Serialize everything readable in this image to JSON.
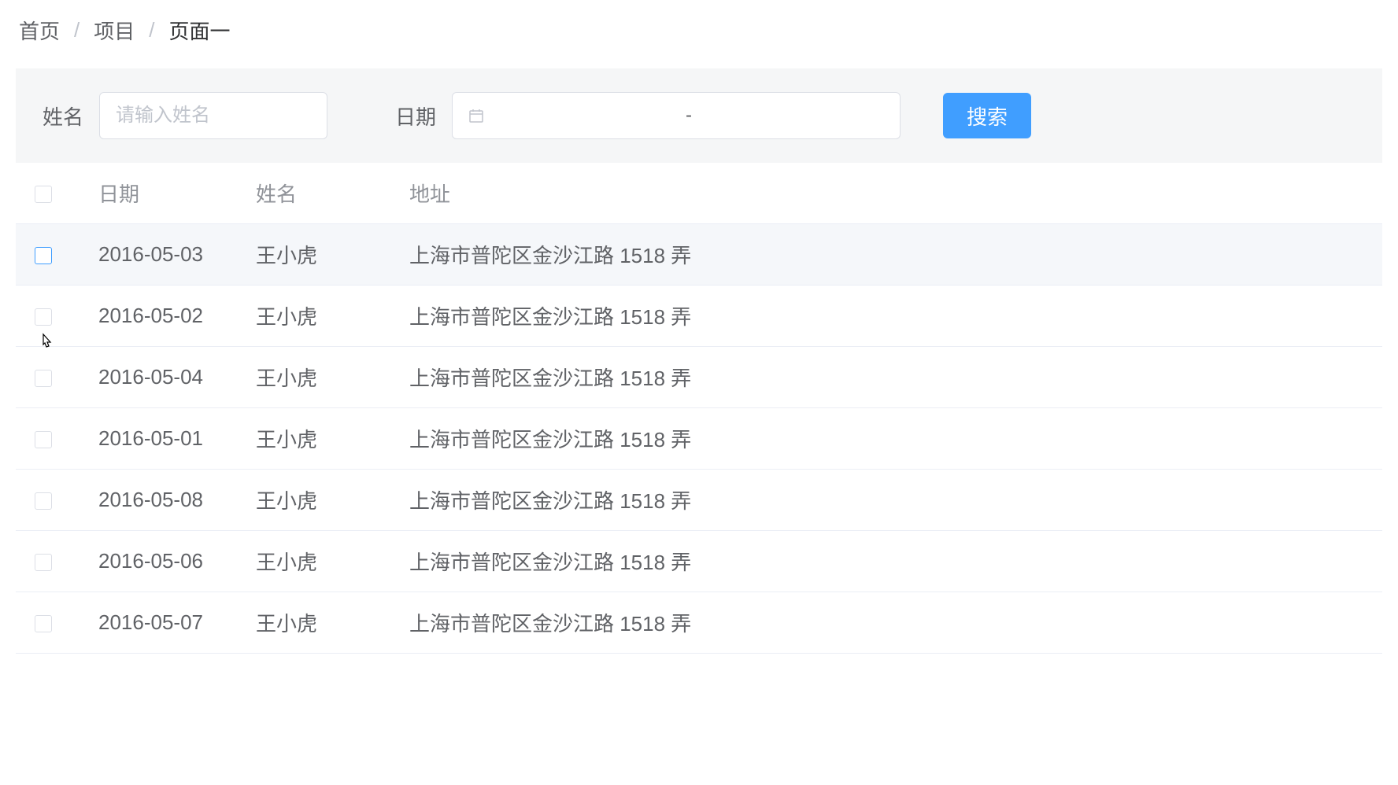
{
  "breadcrumb": {
    "home": "首页",
    "project": "项目",
    "page": "页面一"
  },
  "filter": {
    "name_label": "姓名",
    "name_placeholder": "请输入姓名",
    "date_label": "日期",
    "date_separator": "-",
    "search_label": "搜索"
  },
  "table": {
    "headers": {
      "date": "日期",
      "name": "姓名",
      "address": "地址"
    },
    "rows": [
      {
        "date": "2016-05-03",
        "name": "王小虎",
        "address": "上海市普陀区金沙江路 1518 弄"
      },
      {
        "date": "2016-05-02",
        "name": "王小虎",
        "address": "上海市普陀区金沙江路 1518 弄"
      },
      {
        "date": "2016-05-04",
        "name": "王小虎",
        "address": "上海市普陀区金沙江路 1518 弄"
      },
      {
        "date": "2016-05-01",
        "name": "王小虎",
        "address": "上海市普陀区金沙江路 1518 弄"
      },
      {
        "date": "2016-05-08",
        "name": "王小虎",
        "address": "上海市普陀区金沙江路 1518 弄"
      },
      {
        "date": "2016-05-06",
        "name": "王小虎",
        "address": "上海市普陀区金沙江路 1518 弄"
      },
      {
        "date": "2016-05-07",
        "name": "王小虎",
        "address": "上海市普陀区金沙江路 1518 弄"
      }
    ]
  }
}
